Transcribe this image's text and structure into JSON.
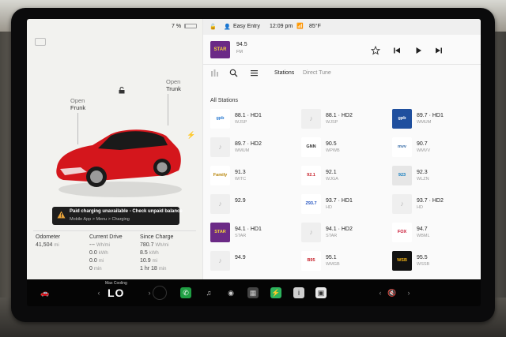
{
  "status_bar": {
    "battery_percent": "7 %",
    "battery_level": 0.07,
    "profile_name": "Easy Entry",
    "time": "12:09 pm",
    "temperature": "85°F"
  },
  "vehicle": {
    "frunk_label_top": "Open",
    "frunk_label_bottom": "Frunk",
    "trunk_label_top": "Open",
    "trunk_label_bottom": "Trunk",
    "car_color": "#d4161c",
    "alert_title": "Paid charging unavailable - Check unpaid balance",
    "alert_detail": "Mobile App > Menu > Charging"
  },
  "trip_stats": {
    "odometer": {
      "label": "Odometer",
      "value": "41,504",
      "unit": "mi"
    },
    "current_drive": {
      "label": "Current Drive",
      "rows": [
        {
          "value": "---",
          "unit": "Wh/mi"
        },
        {
          "value": "0.0",
          "unit": "kWh"
        },
        {
          "value": "0.0",
          "unit": "mi"
        },
        {
          "value": "0",
          "unit": "min"
        }
      ]
    },
    "since_charge": {
      "label": "Since Charge",
      "rows": [
        {
          "value": "780.7",
          "unit": "Wh/mi"
        },
        {
          "value": "8.5",
          "unit": "kWh"
        },
        {
          "value": "10.9",
          "unit": "mi"
        },
        {
          "value": "1 hr 18",
          "unit": "min"
        }
      ]
    }
  },
  "now_playing": {
    "logo_text": "STAR",
    "frequency": "94.5",
    "band": "FM"
  },
  "tabs": {
    "stations": "Stations",
    "direct_tune": "Direct Tune"
  },
  "station_list": {
    "heading": "All Stations",
    "stations": [
      {
        "name": "88.1 · HD1",
        "sub": "WJSP",
        "logo": "gpb",
        "logo_bg": "#ffffff",
        "logo_fg": "#2c7bd1"
      },
      {
        "name": "88.1 · HD2",
        "sub": "WJSP",
        "logo": "♪",
        "logo_bg": "#efefef",
        "logo_fg": "#bbbbbb"
      },
      {
        "name": "89.7 · HD1",
        "sub": "WMUM",
        "logo": "gpb",
        "logo_bg": "#1f4f9e",
        "logo_fg": "#ffffff"
      },
      {
        "name": "89.7 · HD2",
        "sub": "WMUM",
        "logo": "♪",
        "logo_bg": "#efefef",
        "logo_fg": "#bbbbbb"
      },
      {
        "name": "90.5",
        "sub": "WPWB",
        "logo": "GNN",
        "logo_bg": "#ffffff",
        "logo_fg": "#333333"
      },
      {
        "name": "90.7",
        "sub": "WMVV",
        "logo": "mvv",
        "logo_bg": "#ffffff",
        "logo_fg": "#3a6ea8"
      },
      {
        "name": "91.3",
        "sub": "WITC",
        "logo": "Family",
        "logo_bg": "#ffffff",
        "logo_fg": "#b8860b"
      },
      {
        "name": "92.1",
        "sub": "WJGA",
        "logo": "92.1",
        "logo_bg": "#ffffff",
        "logo_fg": "#c8232c"
      },
      {
        "name": "92.3",
        "sub": "WLZN",
        "logo": "923",
        "logo_bg": "#e6e6e6",
        "logo_fg": "#0f7bbf"
      },
      {
        "name": "92.9",
        "sub": "",
        "logo": "♪",
        "logo_bg": "#efefef",
        "logo_fg": "#bbbbbb"
      },
      {
        "name": "93.7 · HD1",
        "sub": "HD",
        "logo": "Z93.7",
        "logo_bg": "#ffffff",
        "logo_fg": "#1d4fbf"
      },
      {
        "name": "93.7 · HD2",
        "sub": "HD",
        "logo": "♪",
        "logo_bg": "#efefef",
        "logo_fg": "#bbbbbb"
      },
      {
        "name": "94.1 · HD1",
        "sub": "STAR",
        "logo": "STAR",
        "logo_bg": "#6b2a86",
        "logo_fg": "#f6d53a"
      },
      {
        "name": "94.1 · HD2",
        "sub": "STAR",
        "logo": "♪",
        "logo_bg": "#efefef",
        "logo_fg": "#bbbbbb"
      },
      {
        "name": "94.7",
        "sub": "WBML",
        "logo": "FOX",
        "logo_bg": "#ffffff",
        "logo_fg": "#c8102e"
      },
      {
        "name": "94.9",
        "sub": "",
        "logo": "♪",
        "logo_bg": "#efefef",
        "logo_fg": "#bbbbbb"
      },
      {
        "name": "95.1",
        "sub": "WMGB",
        "logo": "B95",
        "logo_bg": "#ffffff",
        "logo_fg": "#c8232c"
      },
      {
        "name": "95.5",
        "sub": "WSSB",
        "logo": "WSB",
        "logo_bg": "#111111",
        "logo_fg": "#f2b316"
      }
    ]
  },
  "taskbar": {
    "climate_label": "Max Cooling",
    "climate_temp": "LO",
    "icons": [
      "car-icon",
      "seat-heater-icon",
      "phone-icon",
      "music-icon",
      "media-icon",
      "apps-icon",
      "charging-icon",
      "info-icon",
      "dashcam-icon",
      "mute-icon"
    ]
  }
}
